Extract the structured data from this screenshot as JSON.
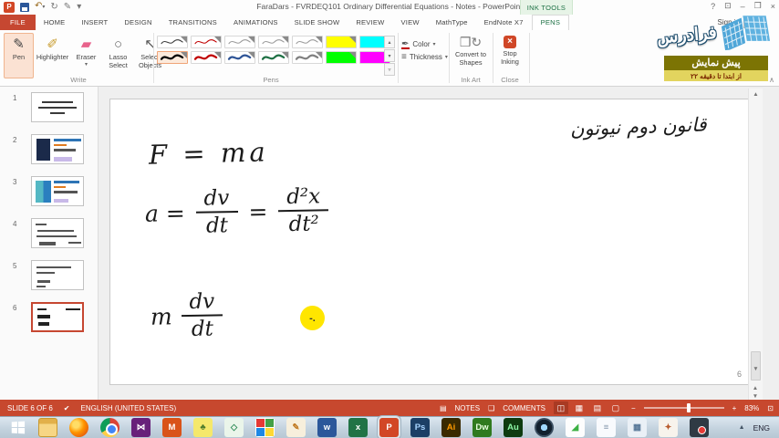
{
  "window": {
    "title": "FaraDars - FVRDEQ101 Ordinary Differential Equations - Notes - PowerPoint",
    "contextual_tab_header": "INK TOOLS",
    "sign_in": "Sign in",
    "help_glyph": "?",
    "minimize_glyph": "–",
    "restore_glyph": "❐",
    "close_glyph": "×",
    "ribbon_display_glyph": "⊡"
  },
  "tabs": [
    "FILE",
    "HOME",
    "INSERT",
    "DESIGN",
    "TRANSITIONS",
    "ANIMATIONS",
    "SLIDE SHOW",
    "REVIEW",
    "VIEW",
    "MathType",
    "EndNote X7",
    "PENS"
  ],
  "active_tab": "PENS",
  "ribbon": {
    "write_group": {
      "label": "Write",
      "buttons": [
        "Pen",
        "Highlighter",
        "Eraser",
        "Lasso Select",
        "Select Objects"
      ],
      "selected": "Pen"
    },
    "pens_group": {
      "label": "Pens",
      "swatches": [
        {
          "color": "#3B3B3B",
          "type": "pen",
          "thick": false,
          "selected": false
        },
        {
          "color": "#C00000",
          "type": "pen",
          "thick": false,
          "selected": false
        },
        {
          "color": "#9B9B9B",
          "type": "pen",
          "thick": false,
          "selected": false
        },
        {
          "color": "#9B9B9B",
          "type": "pen",
          "thick": false,
          "selected": false
        },
        {
          "color": "#9B9B9B",
          "type": "pen",
          "thick": false,
          "selected": false
        },
        {
          "color": "#FFFF00",
          "type": "hl",
          "selected": false
        },
        {
          "color": "#00FFFF",
          "type": "hl",
          "selected": false
        },
        {
          "color": "#000000",
          "type": "pen",
          "thick": true,
          "selected": true
        },
        {
          "color": "#C00000",
          "type": "pen",
          "thick": true,
          "selected": false
        },
        {
          "color": "#2E5496",
          "type": "pen",
          "thick": true,
          "selected": false
        },
        {
          "color": "#1F7145",
          "type": "pen",
          "thick": true,
          "selected": false
        },
        {
          "color": "#808080",
          "type": "pen",
          "thick": true,
          "selected": false
        },
        {
          "color": "#00FF00",
          "type": "hl",
          "selected": false
        },
        {
          "color": "#FF00FF",
          "type": "hl",
          "selected": false
        }
      ]
    },
    "color_label": "Color",
    "thickness_label": "Thickness",
    "ink_art_group": {
      "label": "Ink Art",
      "button": "Convert to Shapes"
    },
    "close_group": {
      "label": "Close",
      "button": "Stop Inking"
    }
  },
  "overlay": {
    "brand": "فرادرس",
    "badge_title": "پیش نمایش",
    "badge_subtitle": "از ابتدا تا دقیقه ۲۲",
    "badge_title_bg": "#7C7404",
    "badge_sub_bg": "#E2D45E"
  },
  "slide_panel": {
    "slides": [
      {
        "num": "1"
      },
      {
        "num": "2"
      },
      {
        "num": "3"
      },
      {
        "num": "4"
      },
      {
        "num": "5"
      },
      {
        "num": "6",
        "selected": true
      }
    ]
  },
  "slide": {
    "ink_title": "قانون دوم نیوتون",
    "eq1": "F = ma",
    "eq2": {
      "lhs": "a =",
      "f1_num": "dv",
      "f1_den": "dt",
      "mid": "=",
      "f2_num": "d²x",
      "f2_den": "dt²"
    },
    "eq3": {
      "lhs": "m",
      "f_num": "dv",
      "f_den": "dt"
    },
    "laser_mark": "-.",
    "laser_color": "#FFE600",
    "page_number": "6"
  },
  "status_bar": {
    "slide_indicator": "SLIDE 6 OF 6",
    "language": "ENGLISH (UNITED STATES)",
    "notes_label": "NOTES",
    "comments_label": "COMMENTS",
    "zoom_percent": "83%",
    "view_buttons": [
      {
        "name": "normal-view",
        "glyph": "◫",
        "active": true
      },
      {
        "name": "slide-sorter-view",
        "glyph": "▦",
        "active": false
      },
      {
        "name": "reading-view",
        "glyph": "▤",
        "active": false
      },
      {
        "name": "slideshow-view",
        "glyph": "▢",
        "active": false
      }
    ]
  },
  "taskbar": {
    "language": "ENG",
    "icons": [
      {
        "name": "file-explorer",
        "cls": "ic-folder"
      },
      {
        "name": "firefox",
        "cls": "ic-firefox"
      },
      {
        "name": "chrome",
        "cls": "ic-chrome"
      },
      {
        "name": "visual-studio",
        "glyph": "⋈",
        "bg": "#68217A",
        "fg": "#FFFFFF"
      },
      {
        "name": "matlab",
        "glyph": "M",
        "bg": "#D95319",
        "fg": "#FFFFFF"
      },
      {
        "name": "maple",
        "glyph": "♣",
        "bg": "#F5E86B",
        "fg": "#4A7A2A"
      },
      {
        "name": "packet-tracer",
        "glyph": "◇",
        "bg": "#EAF5EA",
        "fg": "#2E8B57"
      },
      {
        "name": "office-suite",
        "cls": "ic-squares"
      },
      {
        "name": "ink-notes",
        "glyph": "✎",
        "bg": "#F7EFDC",
        "fg": "#C07820"
      },
      {
        "name": "word",
        "glyph": "w",
        "bg": "#2B579A",
        "fg": "#FFFFFF"
      },
      {
        "name": "excel",
        "glyph": "x",
        "bg": "#217346",
        "fg": "#FFFFFF"
      },
      {
        "name": "powerpoint",
        "glyph": "P",
        "bg": "#D24726",
        "fg": "#FFFFFF",
        "active": true
      },
      {
        "name": "photoshop",
        "glyph": "Ps",
        "bg": "#1C3F66",
        "fg": "#A8D4FF"
      },
      {
        "name": "illustrator",
        "glyph": "Ai",
        "bg": "#3A2A00",
        "fg": "#FF9A00"
      },
      {
        "name": "dreamweaver",
        "glyph": "Dw",
        "bg": "#2F7A1F",
        "fg": "#E8FFE0"
      },
      {
        "name": "audition",
        "glyph": "Au",
        "bg": "#0E3B10",
        "fg": "#8CF7A6"
      },
      {
        "name": "media-player",
        "cls": "ic-media"
      },
      {
        "name": "snagit",
        "glyph": "◢",
        "bg": "#FDFDFD",
        "fg": "#3CB043"
      },
      {
        "name": "notepad",
        "glyph": "≡",
        "bg": "#F8FAFD",
        "fg": "#8A9BB0"
      },
      {
        "name": "calculator",
        "glyph": "▦",
        "bg": "#EAF0F6",
        "fg": "#5A7A9A"
      },
      {
        "name": "paint",
        "glyph": "✦",
        "bg": "#F7F3EC",
        "fg": "#B85C2E"
      },
      {
        "name": "screen-recorder",
        "cls": "ic-recorder"
      }
    ]
  }
}
